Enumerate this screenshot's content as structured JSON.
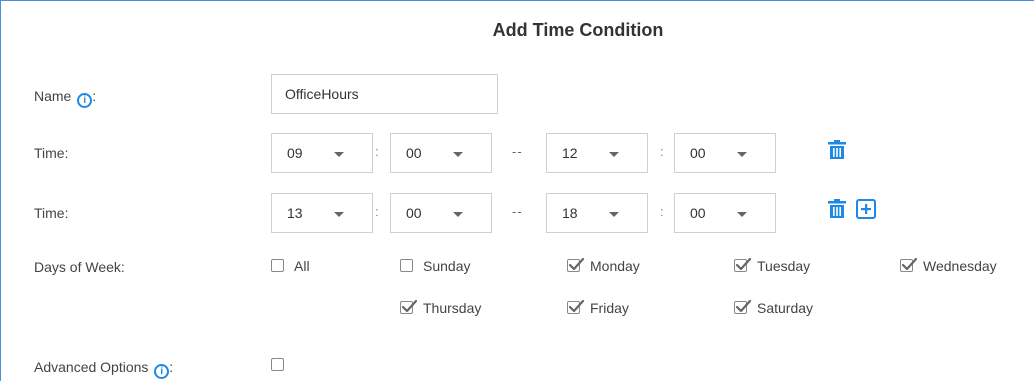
{
  "title": "Add Time Condition",
  "name_field": {
    "label": "Name",
    "colon": ":",
    "value": "OfficeHours"
  },
  "info_glyph": "i",
  "time_rows": [
    {
      "label": "Time:",
      "start_hour": "09",
      "start_min": "00",
      "end_hour": "12",
      "end_min": "00"
    },
    {
      "label": "Time:",
      "start_hour": "13",
      "start_min": "00",
      "end_hour": "18",
      "end_min": "00"
    }
  ],
  "time_separator": ":",
  "range_separator": "--",
  "days": {
    "label": "Days of Week:",
    "items": [
      {
        "label": "All",
        "checked": false
      },
      {
        "label": "Sunday",
        "checked": false
      },
      {
        "label": "Monday",
        "checked": true
      },
      {
        "label": "Tuesday",
        "checked": true
      },
      {
        "label": "Wednesday",
        "checked": true
      },
      {
        "label": "Thursday",
        "checked": true
      },
      {
        "label": "Friday",
        "checked": true
      },
      {
        "label": "Saturday",
        "checked": true
      }
    ]
  },
  "advanced": {
    "label": "Advanced Options",
    "colon": ":",
    "checked": false
  },
  "colors": {
    "accent": "#1e88e5",
    "border": "#d0d0d0",
    "panel_border": "#4a90d9"
  },
  "icons": {
    "delete": "trash-icon",
    "add": "plus-icon",
    "info": "info-icon"
  }
}
